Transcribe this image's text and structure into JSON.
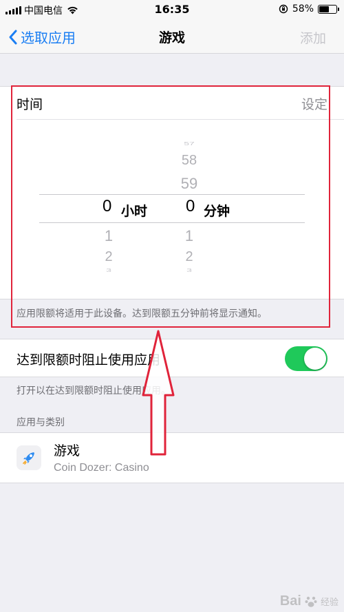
{
  "status_bar": {
    "carrier": "中国电信",
    "time": "16:35",
    "battery": "58%",
    "battery_level": 0.58
  },
  "nav": {
    "back_label": "选取应用",
    "title": "游戏",
    "add_label": "添加"
  },
  "time_card": {
    "label": "时间",
    "set_label": "设定",
    "picker": {
      "hours_above": [
        "",
        "",
        ""
      ],
      "minutes_above": [
        "57",
        "58",
        "59"
      ],
      "hours_selected": "0",
      "hours_unit": "小时",
      "minutes_selected": "0",
      "minutes_unit": "分钟",
      "hours_below": [
        "1",
        "2",
        "3"
      ],
      "minutes_below": [
        "1",
        "2",
        "3"
      ]
    },
    "footnote": "应用限额将适用于此设备。达到限额五分钟前将显示通知。"
  },
  "block_toggle": {
    "label": "达到限额时阻止使用应用",
    "enabled": true,
    "color": "#1fc95a",
    "footnote": "打开以在达到限额时阻止使用应用。"
  },
  "apps_section": {
    "title": "应用与类别",
    "items": [
      {
        "name": "游戏",
        "subtitle": "Coin Dozer: Casino",
        "icon": "rocket-icon"
      }
    ]
  },
  "watermark": {
    "text": "Bai",
    "suffix": "经验",
    "url": "jingyan.baidu.com"
  },
  "colors": {
    "accent": "#1a7ef3",
    "annotation": "#e0233a"
  }
}
